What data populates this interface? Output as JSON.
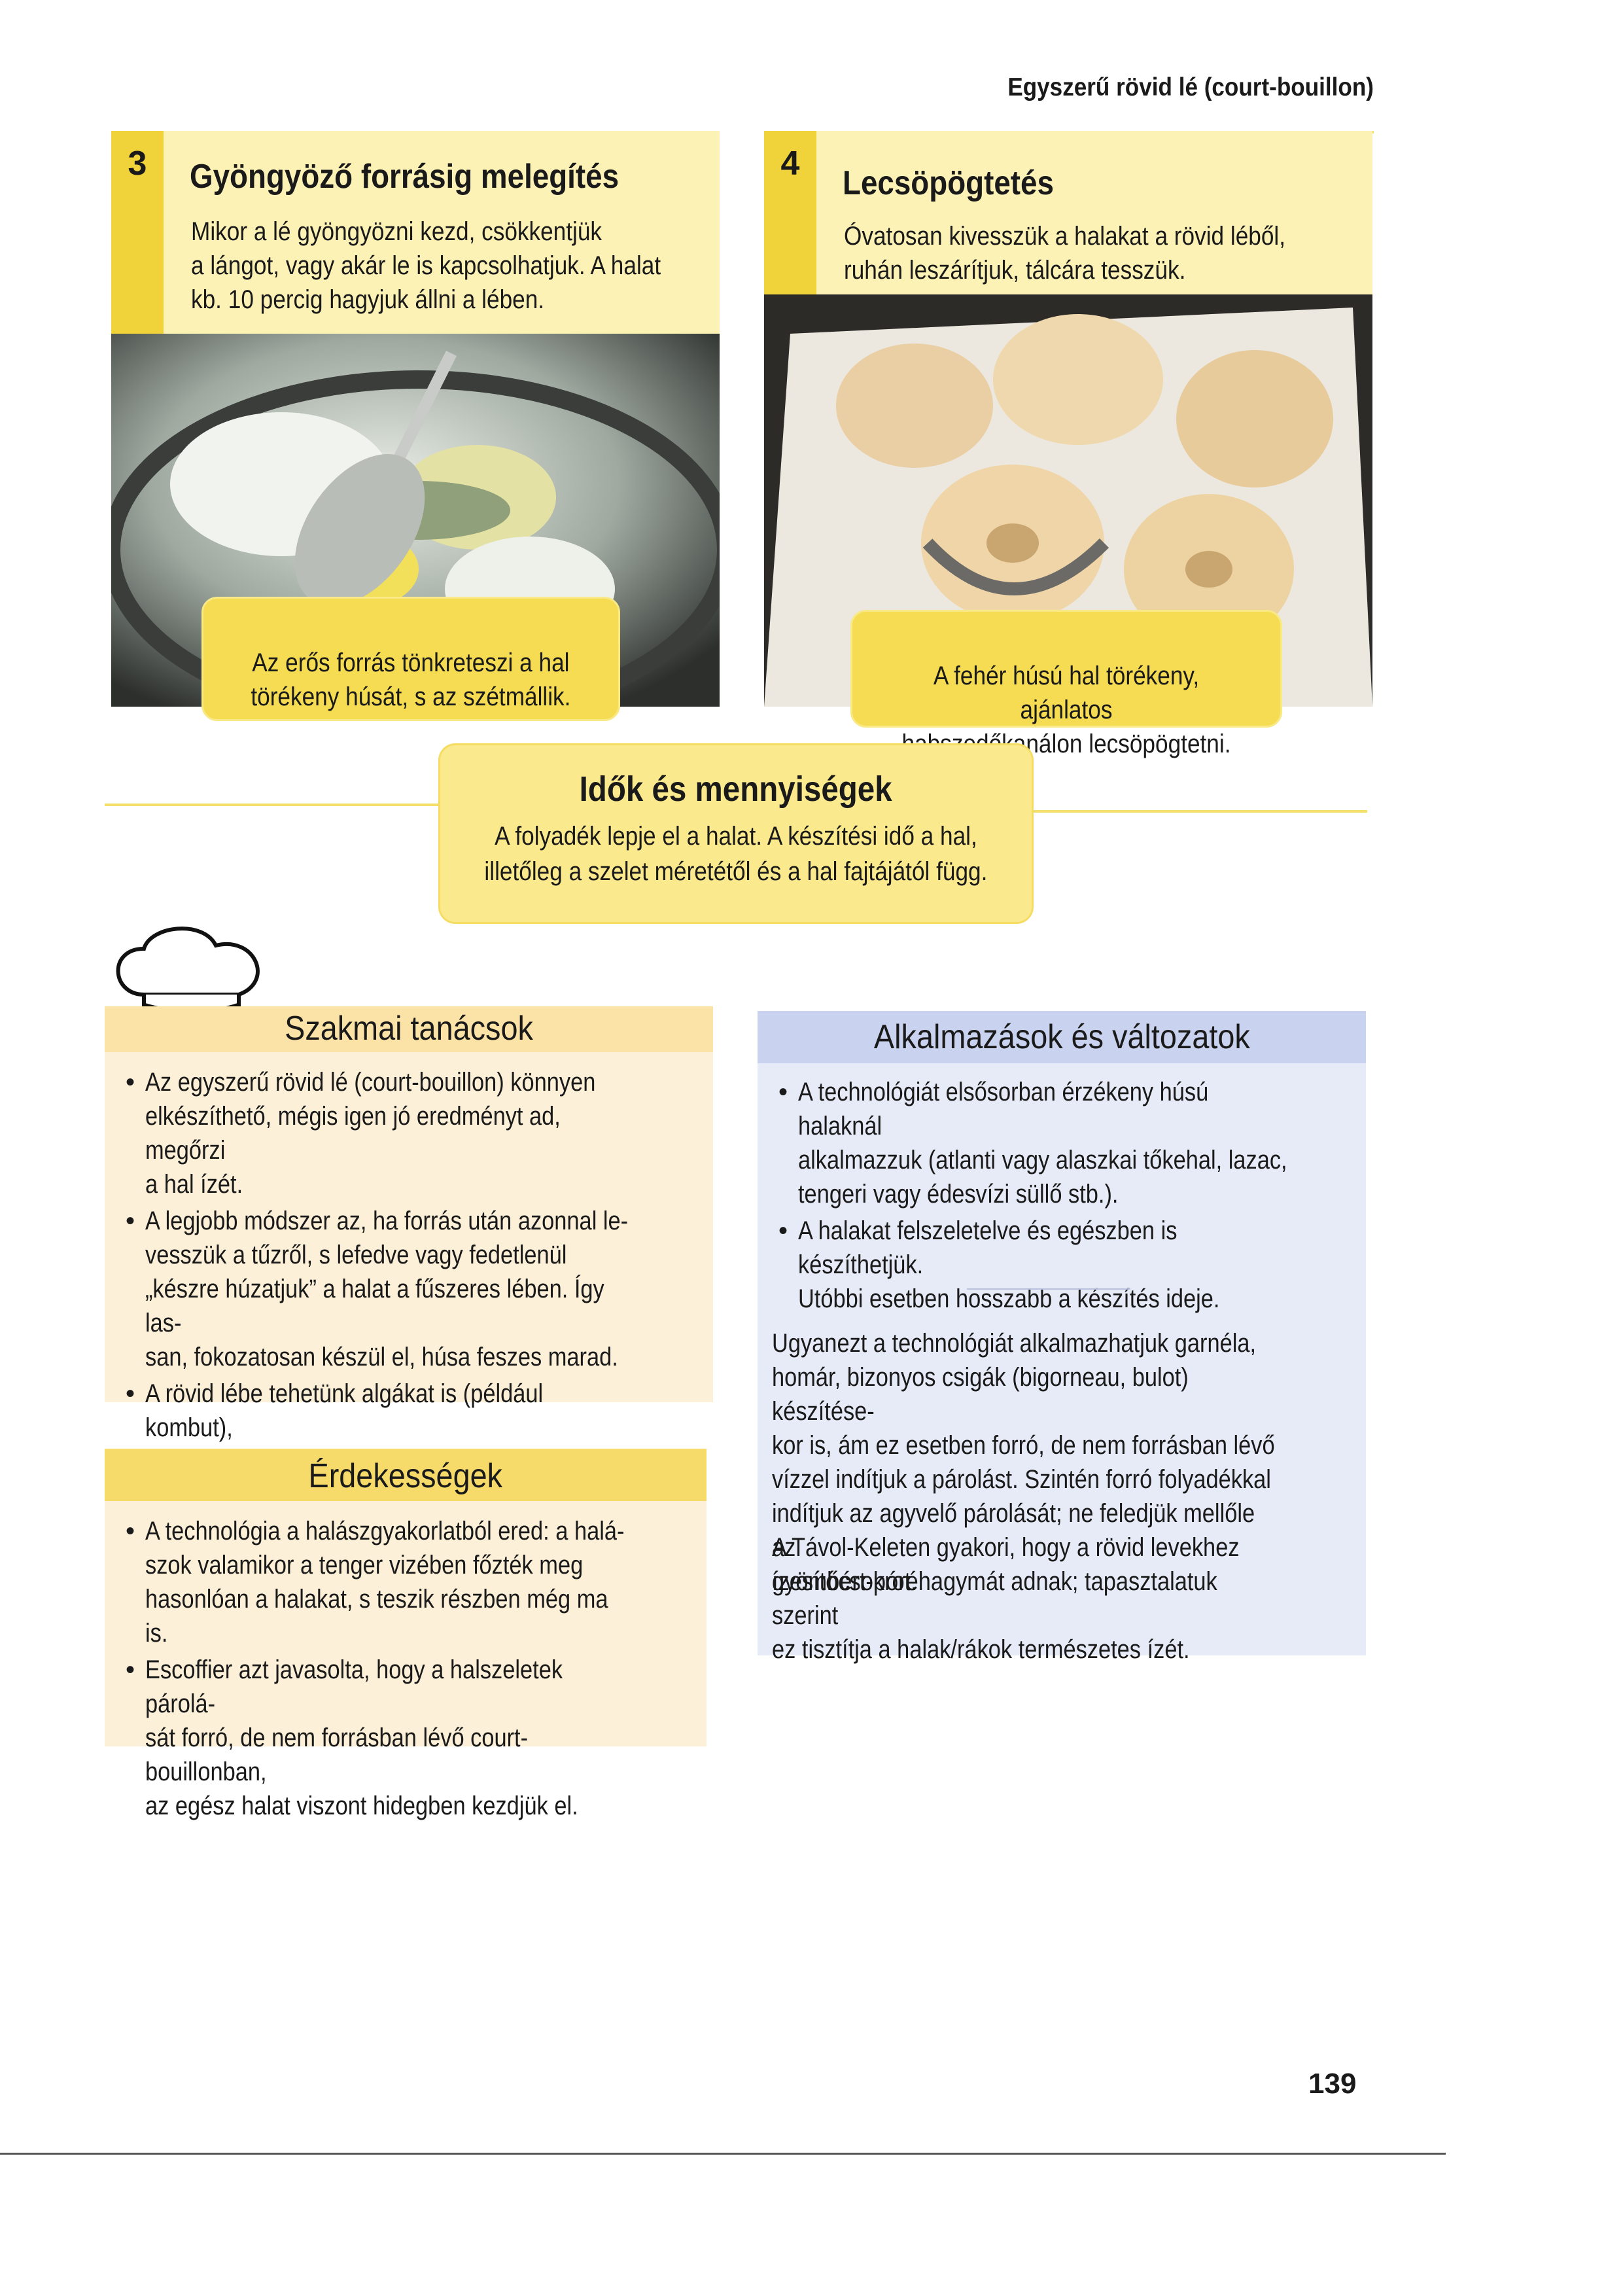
{
  "running_head": "Egyszerű rövid lé (court-bouillon)",
  "steps": [
    {
      "number": "3",
      "title": "Gyöngyöző forrásig melegítés",
      "text": "Mikor a lé gyöngyözni kezd, csökkentjük\na lángot, vagy akár le is kapcsolhatjuk. A halat\nkb. 10 percig hagyjuk állni a lében.",
      "callout": "Az erős forrás tönkreteszi a hal\ntörékeny húsát, s az szétmállik."
    },
    {
      "number": "4",
      "title": "Lecsöpögtetés",
      "text": "Óvatosan kivesszük a halakat a rövid léből,\nruhán leszárítjuk, tálcára tesszük.",
      "callout": "A fehér húsú hal törékeny, ajánlatos\nhabszedőkanálon lecsöpögtetni."
    }
  ],
  "times": {
    "title": "Idők és mennyiségek",
    "text": "A folyadék lepje el a halat. A készítési idő a hal,\nilletőleg a szelet méretétől és a hal fajtájától függ."
  },
  "tips": {
    "title": "Szakmai tanácsok",
    "items": [
      "Az egyszerű rövid lé (court-bouillon) könnyen\nelkészíthető, mégis igen jó eredményt ad, megőrzi\na hal ízét.",
      "A legjobb módszer az, ha forrás után azonnal le-\nvesszük a tűzről, s lefedve vagy fedetlenül\n„készre húzatjuk” a halat a fűszeres lében. Így las-\nsan, fokozatosan készül el, húsa feszes marad.",
      "A rövid lébe tehetünk algákat is (például kombut),\nezek kiemelik a hal ízét."
    ]
  },
  "facts": {
    "title": "Érdekességek",
    "items": [
      "A technológia a halászgyakorlatból ered: a halá-\nszok valamikor a tenger vizében főzték meg\nhasonlóan a halakat, s teszik részben még ma is.",
      "Escoffier azt javasolta, hogy a halszeletek párolá-\nsát forró, de nem forrásban lévő court-bouillonban,\naz egész halat viszont hidegben kezdjük el."
    ]
  },
  "applications": {
    "title": "Alkalmazások és változatok",
    "items": [
      "A technológiát elsősorban érzékeny húsú halaknál\nalkalmazzuk (atlanti vagy alaszkai tőkehal, lazac,\ntengeri vagy édesvízi süllő stb.).",
      "A halakat felszeletelve és egészben is készíthetjük.\nUtóbbi esetben hosszabb a készítés ideje."
    ],
    "paragraph1": "Ugyanezt a technológiát alkalmazhatjuk garnéla,\nhomár, bizonyos csigák (bigorneau, bulot) készítése-\nkor is, ám ez esetben forró, de nem forrásban lévő\nvízzel indítjuk a párolást. Szintén forró folyadékkal\nindítjuk az agyvelő párolását; ne feledjük mellőle az\nízesítőcsokrot.",
    "paragraph2": "A Távol-Keleten gyakori, hogy a rövid levekhez\ngyömbért-póréhagymát adnak; tapasztalatuk szerint\nez tisztítja a halak/rákok természetes ízét."
  },
  "page_number": "139",
  "colors": {
    "yellow": "#f0d23a",
    "pale_yellow": "#fdf2b6",
    "tips_bg": "#fdf0d8",
    "tips_head": "#fbe3a8",
    "applications_bg": "#e6ebf7",
    "applications_head": "#c9d3ef"
  },
  "icons": [
    "chef-hat-icon"
  ]
}
